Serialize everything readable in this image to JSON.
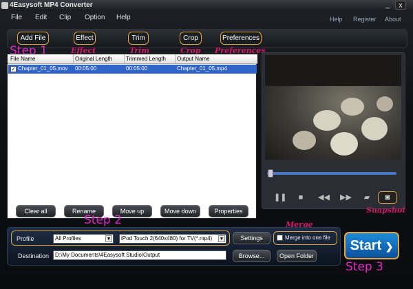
{
  "window": {
    "title": "4Easysoft MP4 Converter",
    "min": "_",
    "close": "x"
  },
  "menu": [
    "File",
    "Edit",
    "Clip",
    "Option",
    "Help"
  ],
  "links": [
    "Help",
    "Register",
    "About"
  ],
  "toolbar": [
    "Add File",
    "Effect",
    "Trim",
    "Crop",
    "Preferences"
  ],
  "annotations": {
    "step1": "Step 1",
    "effect": "Effect",
    "trim": "Trim",
    "crop": "Crop",
    "preferences": "Preferences",
    "step2": "Step 2",
    "step3": "Step 3",
    "merge": "Merge",
    "snapshot": "Snapshot"
  },
  "table": {
    "headers": [
      "File Name",
      "Original Length",
      "Trimmed Length",
      "Output Name"
    ],
    "rows": [
      {
        "checked": true,
        "file": "Chapter_01_05.mov",
        "orig": "00:05:00",
        "trim": "00:05:00",
        "out": "Chapter_01_05.mp4"
      }
    ]
  },
  "list_buttons": [
    "Clear all",
    "Rename",
    "Move up",
    "Move down",
    "Properties"
  ],
  "profile": {
    "label": "Profile",
    "category": "All Profiles",
    "format": "iPod Touch 2(640x480) for TV(*.mp4)",
    "settings": "Settings",
    "merge": "Merge into one file"
  },
  "destination": {
    "label": "Destination",
    "path": "D:\\My Documents\\4Easysoft Studio\\Output",
    "browse": "Browse...",
    "open": "Open Folder"
  },
  "start": "Start",
  "player_icons": [
    "pause-icon",
    "stop-icon",
    "rewind-icon",
    "forward-icon",
    "open-folder-icon",
    "camera-icon"
  ],
  "colors": {
    "accent": "#e2a53b",
    "annotation": "#e026c8",
    "selection": "#3164c8",
    "start": "#1e8cd8"
  }
}
